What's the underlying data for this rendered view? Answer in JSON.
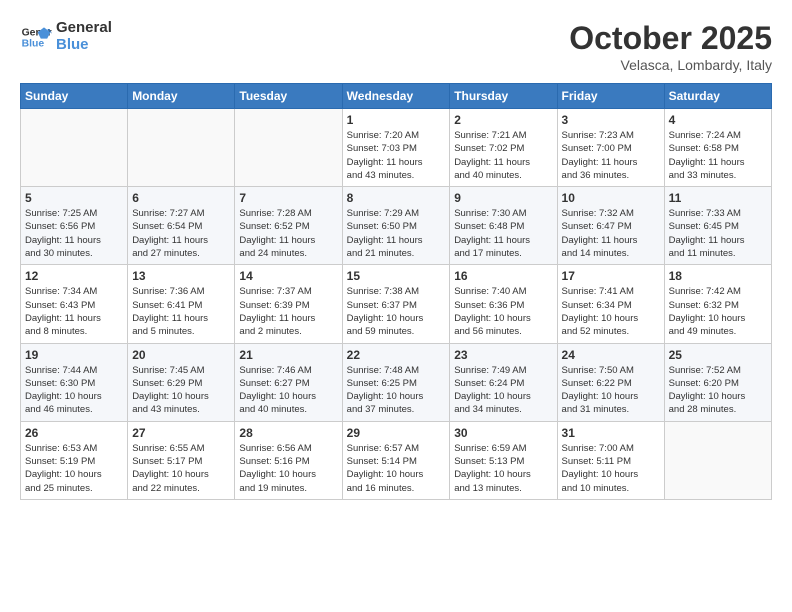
{
  "header": {
    "logo_general": "General",
    "logo_blue": "Blue",
    "month_title": "October 2025",
    "location": "Velasca, Lombardy, Italy"
  },
  "weekdays": [
    "Sunday",
    "Monday",
    "Tuesday",
    "Wednesday",
    "Thursday",
    "Friday",
    "Saturday"
  ],
  "weeks": [
    [
      {
        "day": "",
        "info": ""
      },
      {
        "day": "",
        "info": ""
      },
      {
        "day": "",
        "info": ""
      },
      {
        "day": "1",
        "info": "Sunrise: 7:20 AM\nSunset: 7:03 PM\nDaylight: 11 hours\nand 43 minutes."
      },
      {
        "day": "2",
        "info": "Sunrise: 7:21 AM\nSunset: 7:02 PM\nDaylight: 11 hours\nand 40 minutes."
      },
      {
        "day": "3",
        "info": "Sunrise: 7:23 AM\nSunset: 7:00 PM\nDaylight: 11 hours\nand 36 minutes."
      },
      {
        "day": "4",
        "info": "Sunrise: 7:24 AM\nSunset: 6:58 PM\nDaylight: 11 hours\nand 33 minutes."
      }
    ],
    [
      {
        "day": "5",
        "info": "Sunrise: 7:25 AM\nSunset: 6:56 PM\nDaylight: 11 hours\nand 30 minutes."
      },
      {
        "day": "6",
        "info": "Sunrise: 7:27 AM\nSunset: 6:54 PM\nDaylight: 11 hours\nand 27 minutes."
      },
      {
        "day": "7",
        "info": "Sunrise: 7:28 AM\nSunset: 6:52 PM\nDaylight: 11 hours\nand 24 minutes."
      },
      {
        "day": "8",
        "info": "Sunrise: 7:29 AM\nSunset: 6:50 PM\nDaylight: 11 hours\nand 21 minutes."
      },
      {
        "day": "9",
        "info": "Sunrise: 7:30 AM\nSunset: 6:48 PM\nDaylight: 11 hours\nand 17 minutes."
      },
      {
        "day": "10",
        "info": "Sunrise: 7:32 AM\nSunset: 6:47 PM\nDaylight: 11 hours\nand 14 minutes."
      },
      {
        "day": "11",
        "info": "Sunrise: 7:33 AM\nSunset: 6:45 PM\nDaylight: 11 hours\nand 11 minutes."
      }
    ],
    [
      {
        "day": "12",
        "info": "Sunrise: 7:34 AM\nSunset: 6:43 PM\nDaylight: 11 hours\nand 8 minutes."
      },
      {
        "day": "13",
        "info": "Sunrise: 7:36 AM\nSunset: 6:41 PM\nDaylight: 11 hours\nand 5 minutes."
      },
      {
        "day": "14",
        "info": "Sunrise: 7:37 AM\nSunset: 6:39 PM\nDaylight: 11 hours\nand 2 minutes."
      },
      {
        "day": "15",
        "info": "Sunrise: 7:38 AM\nSunset: 6:37 PM\nDaylight: 10 hours\nand 59 minutes."
      },
      {
        "day": "16",
        "info": "Sunrise: 7:40 AM\nSunset: 6:36 PM\nDaylight: 10 hours\nand 56 minutes."
      },
      {
        "day": "17",
        "info": "Sunrise: 7:41 AM\nSunset: 6:34 PM\nDaylight: 10 hours\nand 52 minutes."
      },
      {
        "day": "18",
        "info": "Sunrise: 7:42 AM\nSunset: 6:32 PM\nDaylight: 10 hours\nand 49 minutes."
      }
    ],
    [
      {
        "day": "19",
        "info": "Sunrise: 7:44 AM\nSunset: 6:30 PM\nDaylight: 10 hours\nand 46 minutes."
      },
      {
        "day": "20",
        "info": "Sunrise: 7:45 AM\nSunset: 6:29 PM\nDaylight: 10 hours\nand 43 minutes."
      },
      {
        "day": "21",
        "info": "Sunrise: 7:46 AM\nSunset: 6:27 PM\nDaylight: 10 hours\nand 40 minutes."
      },
      {
        "day": "22",
        "info": "Sunrise: 7:48 AM\nSunset: 6:25 PM\nDaylight: 10 hours\nand 37 minutes."
      },
      {
        "day": "23",
        "info": "Sunrise: 7:49 AM\nSunset: 6:24 PM\nDaylight: 10 hours\nand 34 minutes."
      },
      {
        "day": "24",
        "info": "Sunrise: 7:50 AM\nSunset: 6:22 PM\nDaylight: 10 hours\nand 31 minutes."
      },
      {
        "day": "25",
        "info": "Sunrise: 7:52 AM\nSunset: 6:20 PM\nDaylight: 10 hours\nand 28 minutes."
      }
    ],
    [
      {
        "day": "26",
        "info": "Sunrise: 6:53 AM\nSunset: 5:19 PM\nDaylight: 10 hours\nand 25 minutes."
      },
      {
        "day": "27",
        "info": "Sunrise: 6:55 AM\nSunset: 5:17 PM\nDaylight: 10 hours\nand 22 minutes."
      },
      {
        "day": "28",
        "info": "Sunrise: 6:56 AM\nSunset: 5:16 PM\nDaylight: 10 hours\nand 19 minutes."
      },
      {
        "day": "29",
        "info": "Sunrise: 6:57 AM\nSunset: 5:14 PM\nDaylight: 10 hours\nand 16 minutes."
      },
      {
        "day": "30",
        "info": "Sunrise: 6:59 AM\nSunset: 5:13 PM\nDaylight: 10 hours\nand 13 minutes."
      },
      {
        "day": "31",
        "info": "Sunrise: 7:00 AM\nSunset: 5:11 PM\nDaylight: 10 hours\nand 10 minutes."
      },
      {
        "day": "",
        "info": ""
      }
    ]
  ]
}
